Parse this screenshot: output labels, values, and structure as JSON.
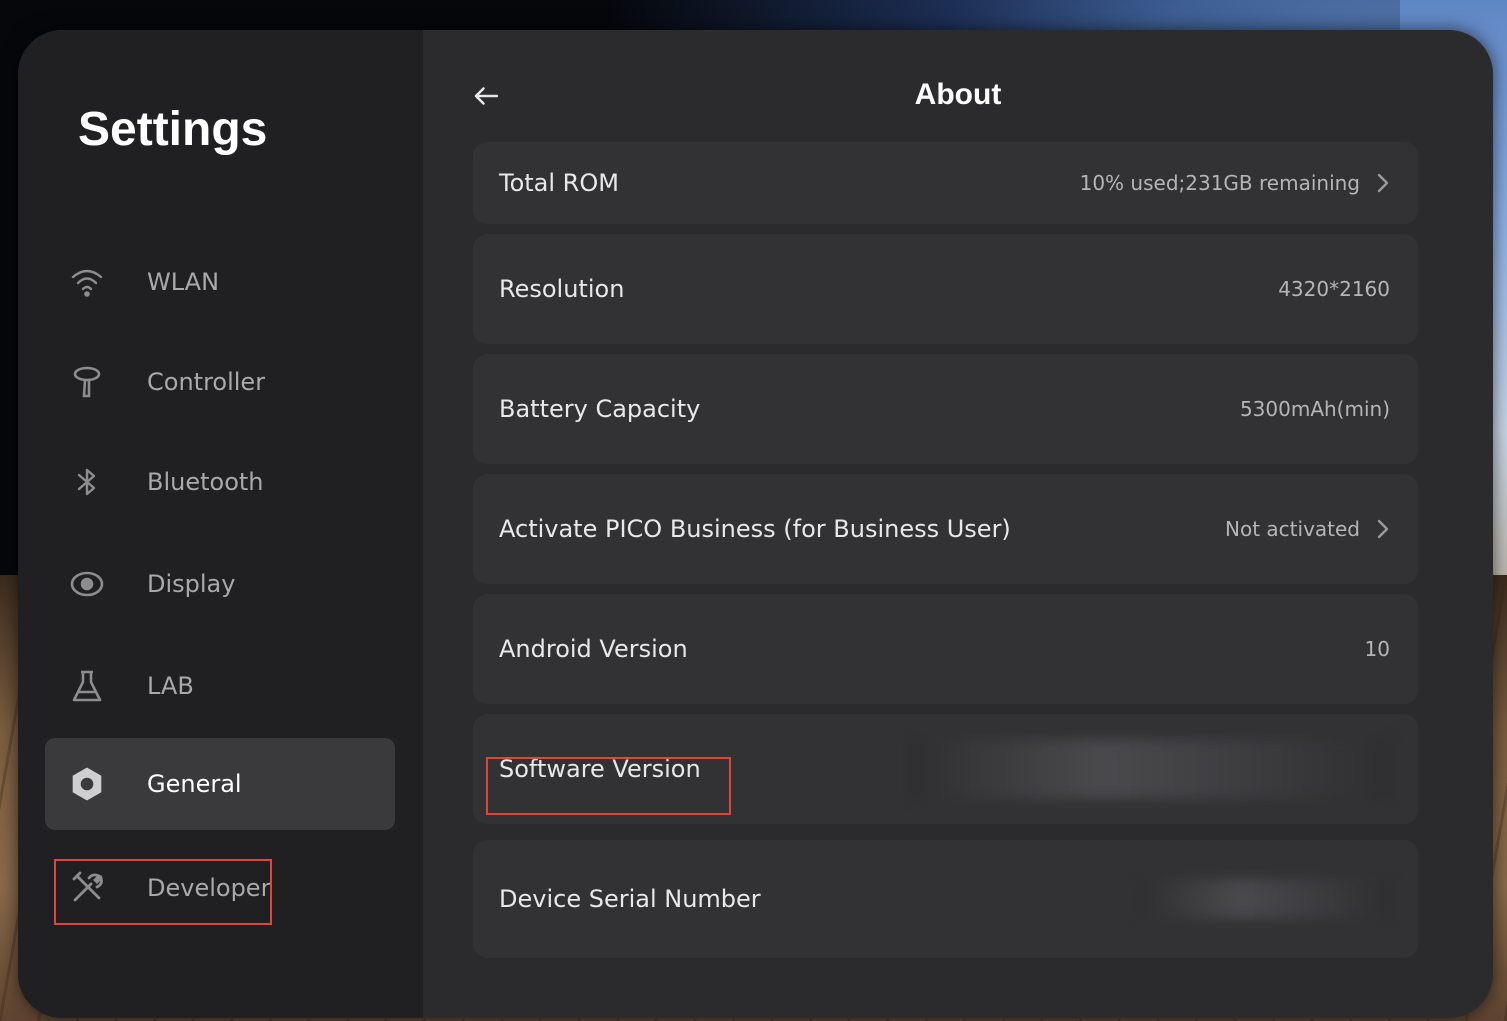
{
  "sidebar": {
    "title": "Settings",
    "items": [
      {
        "label": "WLAN",
        "icon": "wifi-icon",
        "active": false
      },
      {
        "label": "Controller",
        "icon": "controller-icon",
        "active": false
      },
      {
        "label": "Bluetooth",
        "icon": "bluetooth-icon",
        "active": false
      },
      {
        "label": "Display",
        "icon": "eye-icon",
        "active": false
      },
      {
        "label": "LAB",
        "icon": "flask-icon",
        "active": false
      },
      {
        "label": "General",
        "icon": "gear-icon",
        "active": true
      },
      {
        "label": "Developer",
        "icon": "tools-icon",
        "active": false,
        "highlighted": true
      }
    ]
  },
  "content": {
    "title": "About",
    "back_icon": "back-arrow-icon",
    "rows": [
      {
        "label": "Total ROM",
        "value": "10% used;231GB  remaining",
        "chevron": true
      },
      {
        "label": "Resolution",
        "value": "4320*2160",
        "chevron": false
      },
      {
        "label": "Battery Capacity",
        "value": "5300mAh(min)",
        "chevron": false
      },
      {
        "label": "Activate PICO Business (for Business User)",
        "value": "Not activated",
        "chevron": true
      },
      {
        "label": "Android Version",
        "value": "10",
        "chevron": false
      },
      {
        "label": "Software Version",
        "value": "",
        "blurred": true,
        "highlighted": true
      },
      {
        "label": "Device Serial Number",
        "value": "",
        "blurred": true
      }
    ]
  },
  "colors": {
    "highlight": "#e0443e",
    "panel_bg": "#2b2b2d",
    "sidebar_bg": "#202022",
    "row_bg": "#323234"
  }
}
